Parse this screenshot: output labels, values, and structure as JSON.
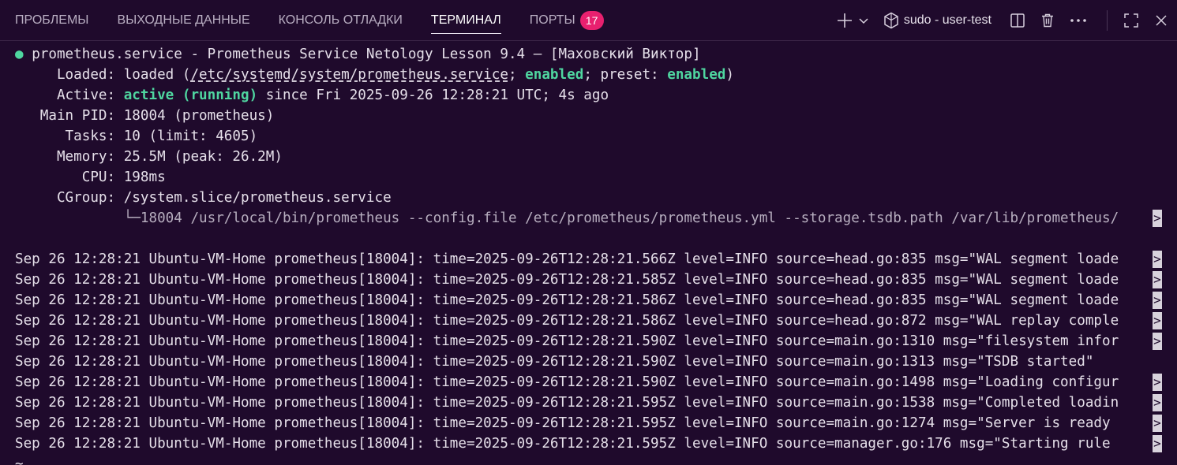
{
  "tabs": [
    {
      "label": "ПРОБЛЕМЫ"
    },
    {
      "label": "ВЫХОДНЫЕ ДАННЫЕ"
    },
    {
      "label": "КОНСОЛЬ ОТЛАДКИ"
    },
    {
      "label": "ТЕРМИНАЛ"
    },
    {
      "label": "ПОРТЫ",
      "badge": "17"
    }
  ],
  "active_tab": "ТЕРМИНАЛ",
  "terminal_title": "sudo - user-test",
  "icons": [
    "plus-icon",
    "chevron-down-icon",
    "terminal-shell-icon",
    "split-icon",
    "trash-icon",
    "more-icon",
    "maximize-icon",
    "close-icon"
  ],
  "colors": {
    "background": "#1f0a2c",
    "accent_green": "#4fd6a0",
    "badge": "#e8206f"
  },
  "status": {
    "bullet": "●",
    "header": "prometheus.service - Prometheus Service Netology Lesson 9.4 — [Маховский Виктор]",
    "loaded_label": "     Loaded: ",
    "loaded_open": "loaded (",
    "loaded_path": "/etc/systemd/system/prometheus.service",
    "loaded_sep": "; ",
    "loaded_enabled": "enabled",
    "loaded_preset": "; preset: ",
    "loaded_preset_val": "enabled",
    "loaded_close": ")",
    "active_label": "     Active: ",
    "active_state": "active (running)",
    "active_rest": " since Fri 2025-09-26 12:28:21 UTC; 4s ago",
    "pid": "   Main PID: 18004 (prometheus)",
    "tasks": "      Tasks: 10 (limit: 4605)",
    "memory": "     Memory: 25.5M (peak: 26.2M)",
    "cpu": "        CPU: 198ms",
    "cgroup": "     CGroup: /system.slice/prometheus.service",
    "cgroup_tree": "             └─18004 /usr/local/bin/prometheus --config.file /etc/prometheus/prometheus.yml --storage.tsdb.path /var/lib/prometheus/"
  },
  "log_lines": [
    "Sep 26 12:28:21 Ubuntu-VM-Home prometheus[18004]: time=2025-09-26T12:28:21.566Z level=INFO source=head.go:835 msg=\"WAL segment loade",
    "Sep 26 12:28:21 Ubuntu-VM-Home prometheus[18004]: time=2025-09-26T12:28:21.585Z level=INFO source=head.go:835 msg=\"WAL segment loade",
    "Sep 26 12:28:21 Ubuntu-VM-Home prometheus[18004]: time=2025-09-26T12:28:21.586Z level=INFO source=head.go:835 msg=\"WAL segment loade",
    "Sep 26 12:28:21 Ubuntu-VM-Home prometheus[18004]: time=2025-09-26T12:28:21.586Z level=INFO source=head.go:872 msg=\"WAL replay comple",
    "Sep 26 12:28:21 Ubuntu-VM-Home prometheus[18004]: time=2025-09-26T12:28:21.590Z level=INFO source=main.go:1310 msg=\"filesystem infor",
    "Sep 26 12:28:21 Ubuntu-VM-Home prometheus[18004]: time=2025-09-26T12:28:21.590Z level=INFO source=main.go:1313 msg=\"TSDB started\"",
    "Sep 26 12:28:21 Ubuntu-VM-Home prometheus[18004]: time=2025-09-26T12:28:21.590Z level=INFO source=main.go:1498 msg=\"Loading configur",
    "Sep 26 12:28:21 Ubuntu-VM-Home prometheus[18004]: time=2025-09-26T12:28:21.595Z level=INFO source=main.go:1538 msg=\"Completed loadin",
    "Sep 26 12:28:21 Ubuntu-VM-Home prometheus[18004]: time=2025-09-26T12:28:21.595Z level=INFO source=main.go:1274 msg=\"Server is ready ",
    "Sep 26 12:28:21 Ubuntu-VM-Home prometheus[18004]: time=2025-09-26T12:28:21.595Z level=INFO source=manager.go:176 msg=\"Starting rule "
  ],
  "truncation_marker": ">",
  "prompt_stub": "~"
}
